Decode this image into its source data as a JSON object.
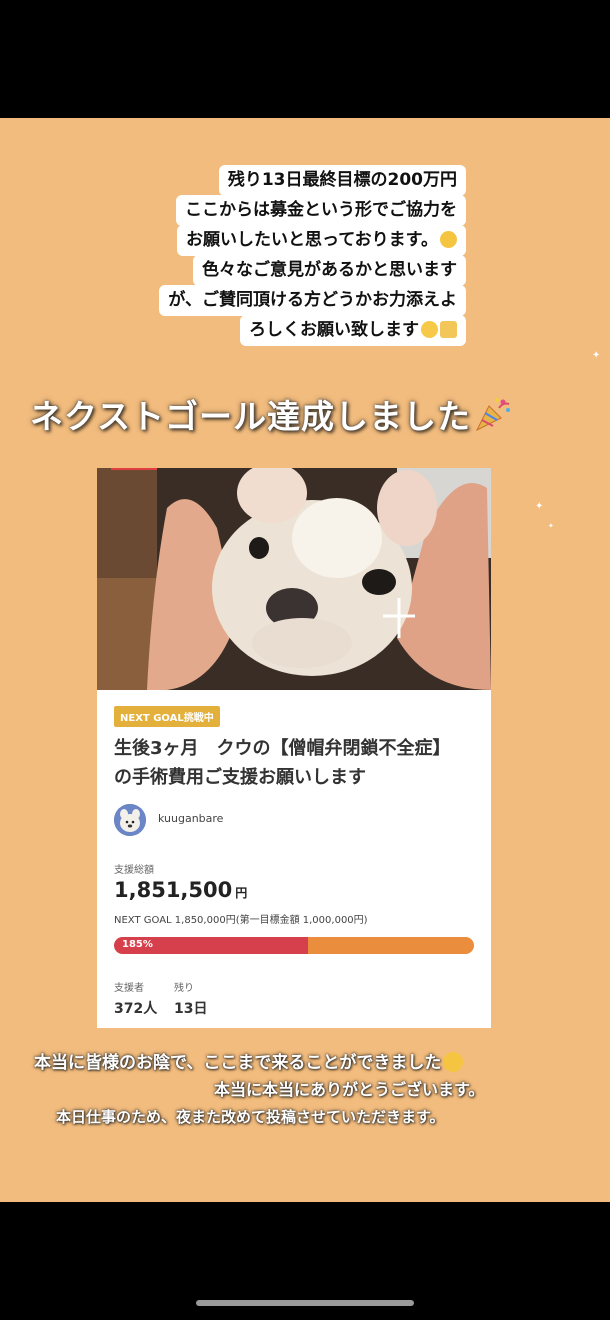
{
  "caption": {
    "lines": [
      "残り13日最終目標の200万円",
      "ここからは募金という形でご協力を",
      "お願いしたいと思っております。",
      "色々なご意見があるかと思います",
      "が、ご賛同頂ける方どうかお力添えよ",
      "ろしくお願い致します"
    ]
  },
  "headline": "ネクストゴール達成しました",
  "card": {
    "badge": "NEXT GOAL挑戦中",
    "title": "生後3ヶ月　クウの【僧帽弁閉鎖不全症】の手術費用ご支援お願いします",
    "username": "kuuganbare",
    "total_label": "支援総額",
    "total_amount": "1,851,500",
    "currency": "円",
    "next_goal": "NEXT GOAL 1,850,000円(第一目標金額 1,000,000円)",
    "progress_percent_label": "185%",
    "progress_fill_fraction": 0.54,
    "supporters_label": "支援者",
    "supporters_value": "372人",
    "remaining_label": "残り",
    "remaining_value": "13日"
  },
  "footer": {
    "line1": "本当に皆様のお陰で、ここまで来ることができました",
    "line2": "本当に本当にありがとうございます。",
    "line3": "本日仕事のため、夜また改めて投稿させていただきます。"
  },
  "colors": {
    "background": "#f2bc7e",
    "progress_fill": "#d6404c",
    "progress_track": "#ea8d3c",
    "badge": "#e3b13b"
  }
}
